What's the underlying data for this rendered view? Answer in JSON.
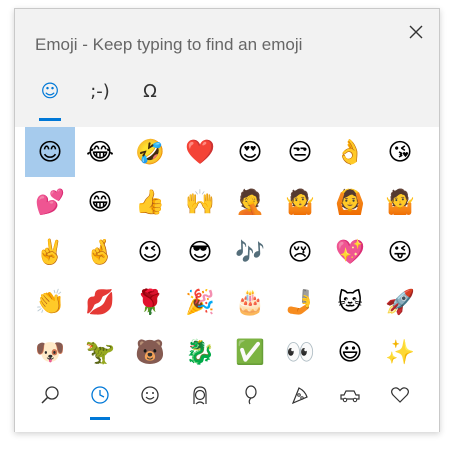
{
  "window": {
    "title": "Emoji - Keep typing to find an emoji",
    "close_icon": "close-icon"
  },
  "tabs": [
    {
      "label": "☺",
      "name": "emoji",
      "active": true
    },
    {
      "label": ";-)",
      "name": "kaomoji",
      "active": false
    },
    {
      "label": "Ω",
      "name": "symbols",
      "active": false
    }
  ],
  "emoji_grid": [
    "😊",
    "😂",
    "🤣",
    "❤️",
    "😍",
    "😒",
    "👌",
    "😘",
    "💕",
    "😁",
    "👍",
    "🙌",
    "🤦",
    "🤷",
    "🙆",
    "🤷",
    "✌️",
    "🤞",
    "😉",
    "😎",
    "🎶",
    "😢",
    "💖",
    "😜",
    "👏",
    "💋",
    "🌹",
    "🎉",
    "🎂",
    "🤳",
    "🐱",
    "🚀",
    "🐶",
    "🦖",
    "🐻",
    "🐉",
    "✅",
    "👀",
    "😃",
    "✨"
  ],
  "selected_index": 0,
  "categories": [
    {
      "glyph": "⚲",
      "name": "search"
    },
    {
      "glyph": "🕒",
      "name": "recent"
    },
    {
      "glyph": "☺",
      "name": "smileys"
    },
    {
      "glyph": "☻",
      "name": "people"
    },
    {
      "glyph": "♡",
      "name": "celebrations"
    },
    {
      "glyph": "◭",
      "name": "food"
    },
    {
      "glyph": "🚗",
      "name": "travel"
    },
    {
      "glyph": "♡",
      "name": "symbols"
    }
  ],
  "accent_color": "#0078d7"
}
